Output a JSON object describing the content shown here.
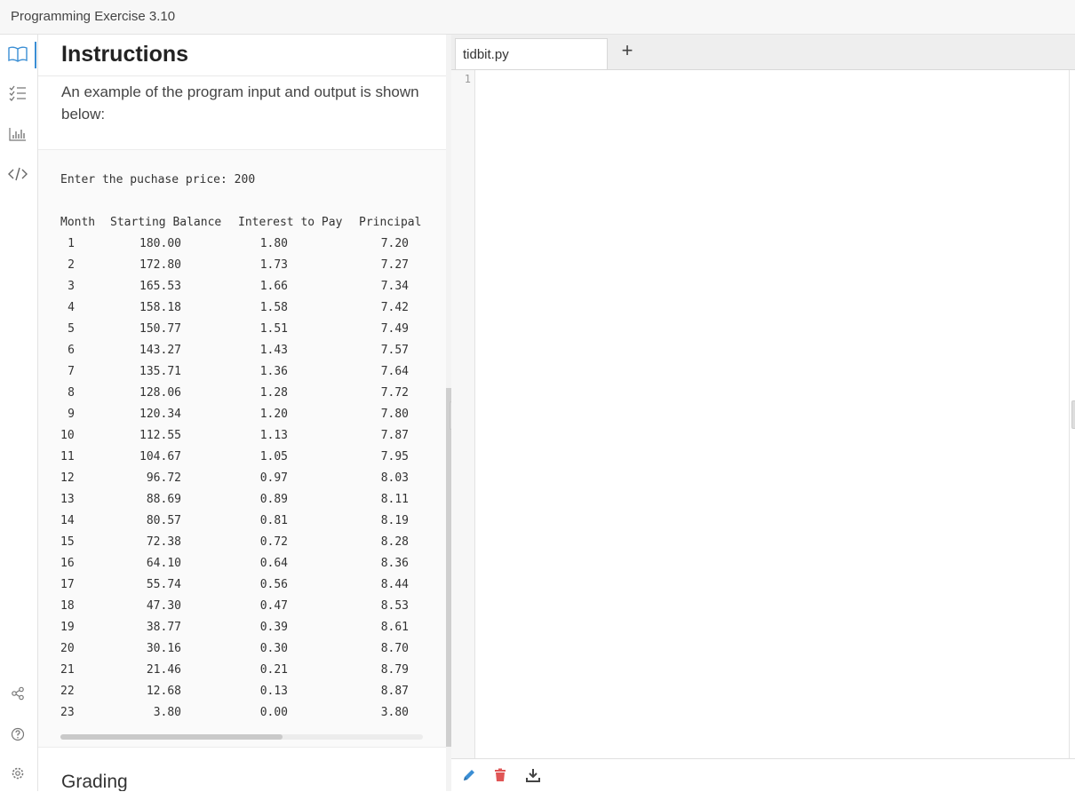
{
  "app": {
    "title": "Programming Exercise 3.10"
  },
  "rail": {
    "icons": [
      "book-icon",
      "checklist-icon",
      "bar-chart-icon",
      "code-icon",
      "share-icon",
      "help-icon",
      "settings-icon"
    ]
  },
  "instructions": {
    "heading": "Instructions",
    "intro": "An example of the program input and output is shown below:",
    "prompt_line": "Enter the puchase price: 200",
    "table": {
      "headers": [
        "Month",
        "Starting Balance",
        "Interest to Pay",
        "Principal"
      ],
      "rows": [
        [
          "1",
          "180.00",
          "1.80",
          "7.20"
        ],
        [
          "2",
          "172.80",
          "1.73",
          "7.27"
        ],
        [
          "3",
          "165.53",
          "1.66",
          "7.34"
        ],
        [
          "4",
          "158.18",
          "1.58",
          "7.42"
        ],
        [
          "5",
          "150.77",
          "1.51",
          "7.49"
        ],
        [
          "6",
          "143.27",
          "1.43",
          "7.57"
        ],
        [
          "7",
          "135.71",
          "1.36",
          "7.64"
        ],
        [
          "8",
          "128.06",
          "1.28",
          "7.72"
        ],
        [
          "9",
          "120.34",
          "1.20",
          "7.80"
        ],
        [
          "10",
          "112.55",
          "1.13",
          "7.87"
        ],
        [
          "11",
          "104.67",
          "1.05",
          "7.95"
        ],
        [
          "12",
          "96.72",
          "0.97",
          "8.03"
        ],
        [
          "13",
          "88.69",
          "0.89",
          "8.11"
        ],
        [
          "14",
          "80.57",
          "0.81",
          "8.19"
        ],
        [
          "15",
          "72.38",
          "0.72",
          "8.28"
        ],
        [
          "16",
          "64.10",
          "0.64",
          "8.36"
        ],
        [
          "17",
          "55.74",
          "0.56",
          "8.44"
        ],
        [
          "18",
          "47.30",
          "0.47",
          "8.53"
        ],
        [
          "19",
          "38.77",
          "0.39",
          "8.61"
        ],
        [
          "20",
          "30.16",
          "0.30",
          "8.70"
        ],
        [
          "21",
          "21.46",
          "0.21",
          "8.79"
        ],
        [
          "22",
          "12.68",
          "0.13",
          "8.87"
        ],
        [
          "23",
          "3.80",
          "0.00",
          "3.80"
        ]
      ]
    },
    "next_heading": "Grading"
  },
  "editor": {
    "tabs": [
      {
        "label": "tidbit.py"
      }
    ],
    "add_tab_label": "+",
    "line_numbers": [
      "1"
    ],
    "code": ""
  },
  "toolbar": {
    "icons": [
      "pencil-icon",
      "trash-icon",
      "download-icon"
    ]
  },
  "colors": {
    "accent": "#3a8ed4",
    "delete": "#e05555"
  }
}
